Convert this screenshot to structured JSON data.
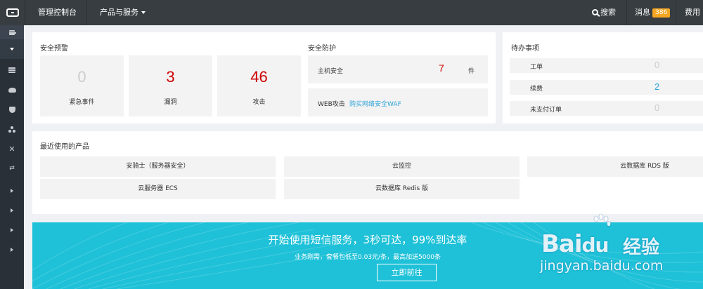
{
  "topbar": {
    "console": "管理控制台",
    "products": "产品与服务",
    "search": "搜索",
    "messages": "消息",
    "message_count": "386",
    "fees": "费用"
  },
  "alert": {
    "title": "安全预警",
    "stats": [
      {
        "value": "0",
        "label": "紧急事件"
      },
      {
        "value": "3",
        "label": "漏洞"
      },
      {
        "value": "46",
        "label": "攻击"
      }
    ]
  },
  "protection": {
    "title": "安全防护",
    "host_label": "主机安全",
    "host_value": "7",
    "host_unit": "件",
    "web_label": "WEB攻击",
    "web_link": "购买网络安全WAF"
  },
  "todo": {
    "title": "待办事项",
    "items": [
      {
        "label": "工单",
        "value": "0"
      },
      {
        "label": "续费",
        "value": "2"
      },
      {
        "label": "未支付订单",
        "value": "0"
      }
    ]
  },
  "recent": {
    "title": "最近使用的产品",
    "products": [
      "安骑士（服务器安全）",
      "云监控",
      "云数据库 RDS 版",
      "云服务器 ECS",
      "云数据库 Redis 版"
    ]
  },
  "banner": {
    "title": "开始使用短信服务，3秒可达，99%到达率",
    "subtitle": "业务刚需，套餐包低至0.03元/条，最高加送5000条",
    "button": "立即前往"
  },
  "watermark": {
    "logo": "Bai",
    "logo2": "du",
    "cn": "经验",
    "url": "jingyan.baidu.com"
  },
  "colors": {
    "topbar": "#373d41",
    "sidebar": "#293038",
    "accent_red": "#cc0000",
    "accent_blue": "#2fa4d8",
    "badge": "#f5a623",
    "banner": "#1ec1d8"
  }
}
